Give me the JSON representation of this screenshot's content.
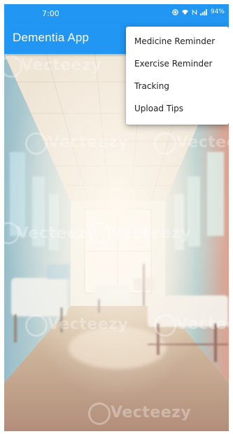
{
  "status_bar": {
    "time": "7:00",
    "battery": "94%"
  },
  "app_bar": {
    "title": "Dementia App"
  },
  "menu": {
    "items": [
      {
        "label": "Medicine Reminder"
      },
      {
        "label": "Exercise Reminder"
      },
      {
        "label": "Tracking"
      },
      {
        "label": "Upload Tips"
      }
    ]
  },
  "background": {
    "watermark_text": "Vecteezy"
  },
  "colors": {
    "primary": "#2196f3",
    "menu_background": "#ffffff",
    "menu_text": "#212121"
  }
}
